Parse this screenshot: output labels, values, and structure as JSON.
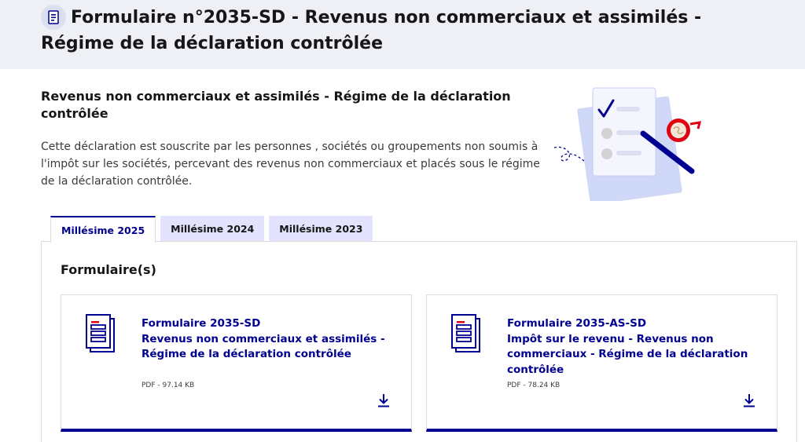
{
  "page": {
    "title": "Formulaire n°2035-SD - Revenus non commerciaux et assimilés - Régime de la déclaration contrôlée",
    "section_title": "Revenus non commerciaux et assimilés - Régime de la déclaration contrôlée",
    "intro": "Cette déclaration est souscrite par les personnes , sociétés ou groupements non soumis à l'impôt sur les sociétés, percevant des revenus non commerciaux et placés sous le régime de la déclaration contrôlée."
  },
  "tabs": [
    {
      "label": "Millésime 2025",
      "active": true
    },
    {
      "label": "Millésime 2024",
      "active": false
    },
    {
      "label": "Millésime 2023",
      "active": false
    }
  ],
  "panel": {
    "title": "Formulaire(s)",
    "cards": [
      {
        "title_line1": "Formulaire 2035-SD",
        "title_line2": "Revenus non commerciaux et assimilés - Régime de la déclaration contrôlée",
        "meta": "PDF - 97.14 KB",
        "icon": "document-icon",
        "action_icon": "download-icon"
      },
      {
        "title_line1": "Formulaire 2035-AS-SD",
        "title_line2": "Impôt sur le revenu - Revenus non commerciaux - Régime de la déclaration contrôlée",
        "meta": "PDF - 78.24 KB",
        "icon": "document-icon",
        "action_icon": "download-icon"
      }
    ]
  },
  "colors": {
    "accent": "#000091",
    "accent_red": "#e1000f",
    "tab_inactive_bg": "#e3e3fd",
    "header_bg": "#eef0f6"
  }
}
